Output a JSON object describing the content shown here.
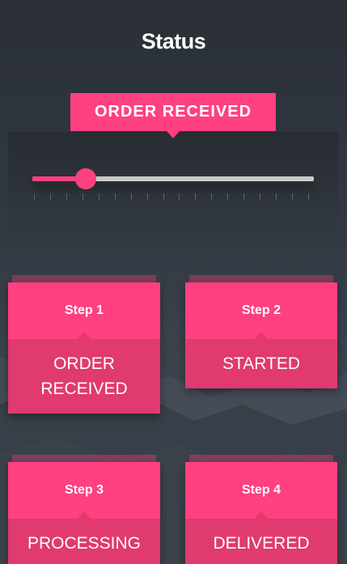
{
  "header": {
    "title": "Status"
  },
  "status": {
    "current_label": "ORDER RECEIVED",
    "progress": 0.19,
    "tick_count": 18
  },
  "steps": [
    {
      "step": "Step 1",
      "label": "ORDER RECEIVED"
    },
    {
      "step": "Step 2",
      "label": "STARTED"
    },
    {
      "step": "Step 3",
      "label": "PROCESSING"
    },
    {
      "step": "Step 4",
      "label": "DELIVERED"
    }
  ],
  "colors": {
    "accent": "#ff4081",
    "accent_dark": "#e03a6f",
    "background": "#30363f",
    "track": "#c9c9c9"
  }
}
